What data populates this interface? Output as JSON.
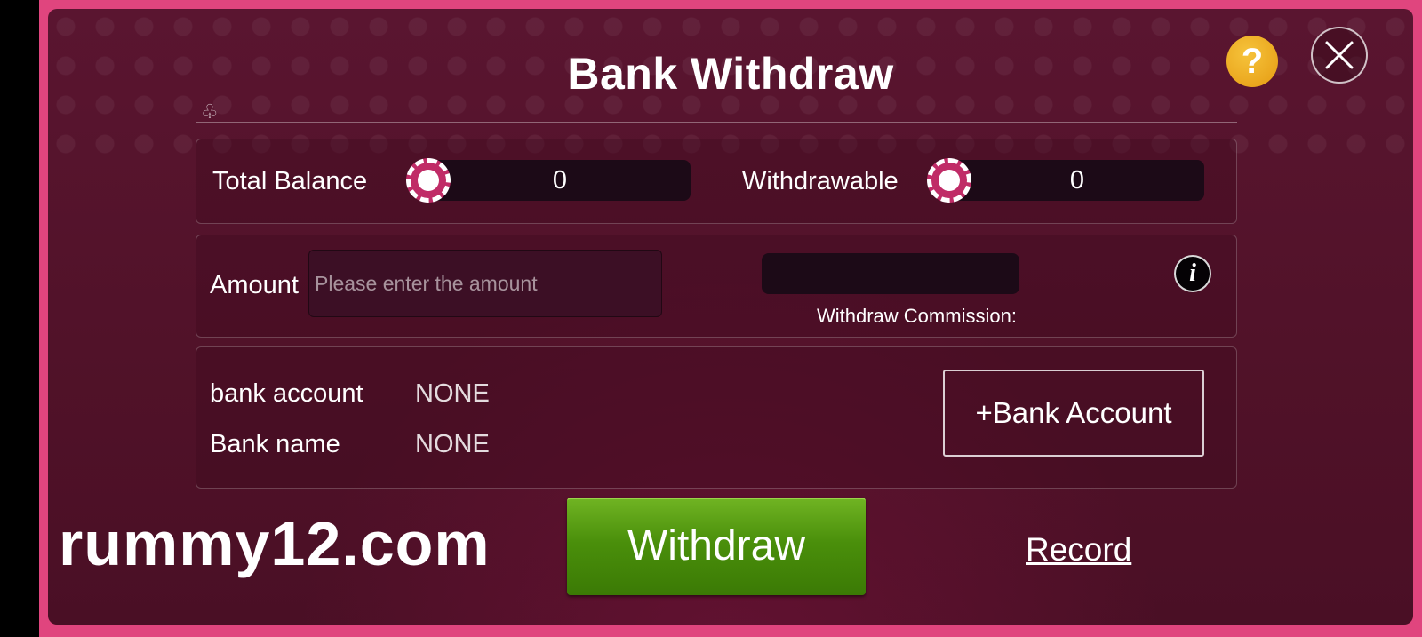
{
  "dialog": {
    "title": "Bank Withdraw",
    "help_symbol": "?",
    "close_symbol": "×"
  },
  "balance": {
    "total_label": "Total Balance",
    "total_value": "0",
    "withdrawable_label": "Withdrawable",
    "withdrawable_value": "0"
  },
  "amount": {
    "label": "Amount",
    "placeholder": "Please enter the amount",
    "value": "",
    "commission_label": "Withdraw Commission:",
    "commission_value": "",
    "info_symbol": "i"
  },
  "bank": {
    "account_label": "bank account",
    "account_value": "NONE",
    "name_label": "Bank name",
    "name_value": "NONE",
    "add_button": "+Bank Account"
  },
  "actions": {
    "withdraw_button": "Withdraw",
    "record_link": "Record"
  },
  "watermark": "rummy12.com",
  "colors": {
    "frame": "#e0457e",
    "background": "#521329",
    "withdraw_green": "#4a8f0b",
    "help_yellow": "#e59b12"
  }
}
